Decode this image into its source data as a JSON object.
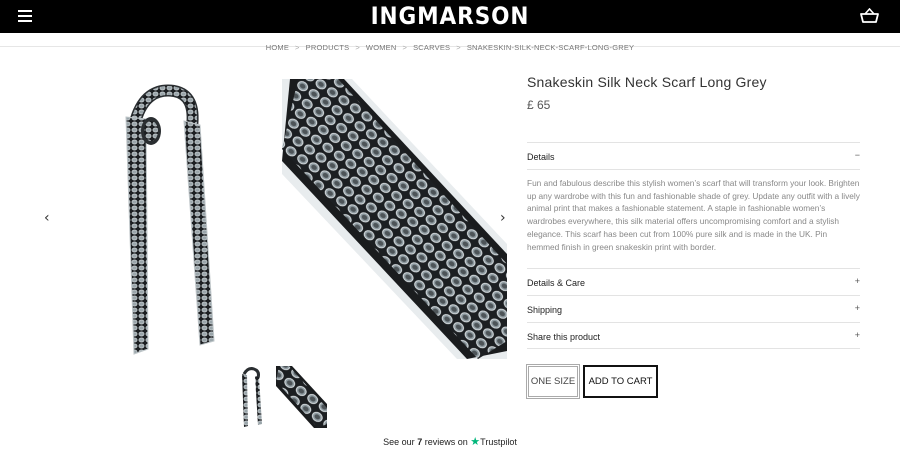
{
  "header": {
    "logo": "INGMARSON",
    "menu_icon": "hamburger-menu-icon",
    "cart_icon": "shopping-basket-icon"
  },
  "breadcrumb": [
    "HOME",
    "PRODUCTS",
    "WOMEN",
    "SCARVES",
    "SNAKESKIN-SILK-NECK-SCARF-LONG-GREY"
  ],
  "product": {
    "title": "Snakeskin Silk Neck Scarf Long Grey",
    "price": "£ 65",
    "description": "Fun and fabulous describe this stylish women’s scarf that will transform your look. Brighten up any wardrobe with this fun and fashionable shade of grey. Update any outfit with a lively animal print that makes a fashionable statement. A staple in fashionable women’s wardrobes everywhere, this silk material offers uncompromising comfort and a stylish elegance. This scarf has been cut from 100% pure silk and is made in the UK. Pin hemmed finish in green snakeskin print with border.",
    "size_label": "ONE SIZE",
    "add_to_cart": "ADD TO CART"
  },
  "accordion": [
    {
      "label": "Details",
      "toggle": "−"
    },
    {
      "label": "Details & Care",
      "toggle": "+"
    },
    {
      "label": "Shipping",
      "toggle": "+"
    },
    {
      "label": "Share this product",
      "toggle": "+"
    }
  ],
  "gallery": {
    "prev_icon": "chevron-left-icon",
    "next_icon": "chevron-right-icon",
    "prev_glyph": "‹",
    "next_glyph": "›"
  },
  "trustpilot": {
    "prefix": "See our",
    "count": "7",
    "middle": "reviews on",
    "brand": "Trustpilot",
    "star_glyph": "★"
  },
  "colors": {
    "header_bg": "#000000",
    "trustpilot_green": "#00b67a"
  }
}
